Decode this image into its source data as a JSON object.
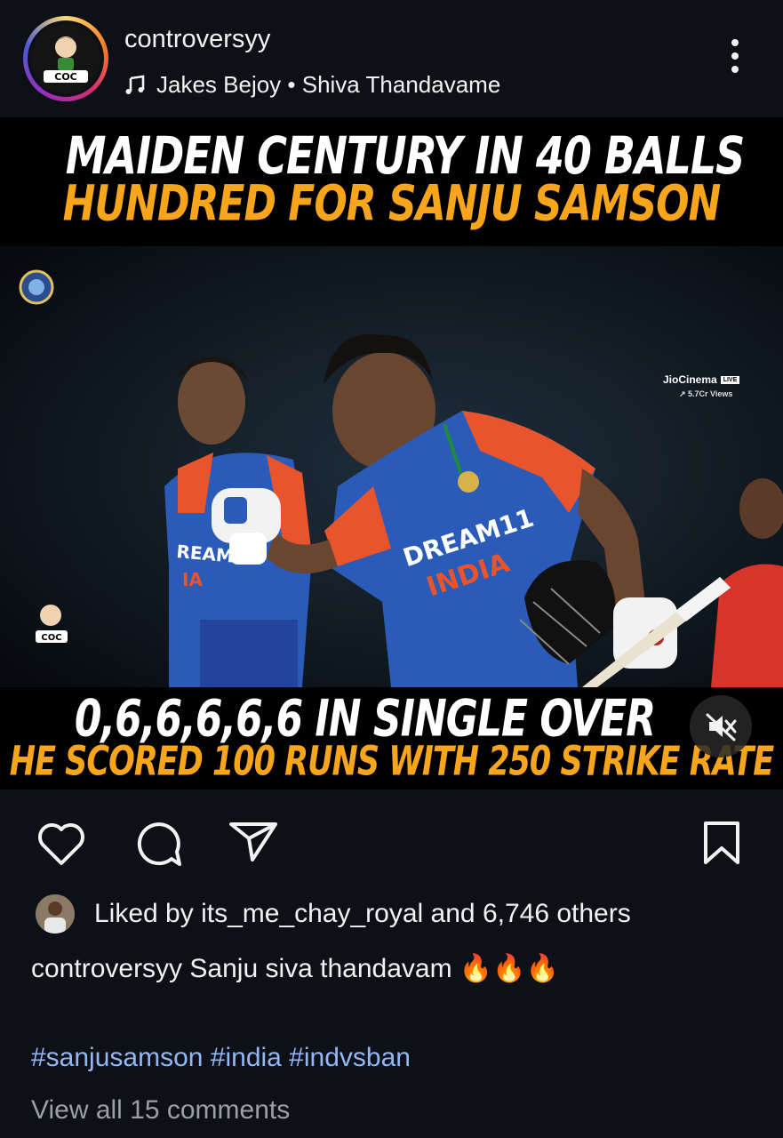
{
  "post": {
    "username": "controversyy",
    "music": "Jakes Bejoy • Shiva Thandavame",
    "avatar_text": "COC"
  },
  "media": {
    "headline_1": "MAIDEN CENTURY IN 40 BALLS",
    "headline_2": "HUNDRED FOR SANJU SAMSON",
    "bottom_1": "0,6,6,6,6,6 IN SINGLE OVER",
    "bottom_2": "HE SCORED 100 RUNS WITH 250 STRIKE RATE",
    "broadcaster": "JioCinema",
    "live_badge": "LIVE",
    "views": "5.7Cr Views",
    "jersey_sponsor": "DREAM11",
    "jersey_team": "INDIA",
    "watermark": "COC"
  },
  "engagement": {
    "likes_prefix": "Liked by ",
    "liked_by": "its_me_chay_royal",
    "likes_middle": " and ",
    "likes_count": "6,746 others",
    "caption_user": "controversyy",
    "caption_text": " Sanju siva thandavam 🔥🔥🔥",
    "hashtags": "#sanjusamson #india #indvsban",
    "view_comments": "View all 15 comments"
  },
  "colors": {
    "background": "#0d1117",
    "headline_orange": "#f7a61c",
    "hashtag_blue": "#93b6f5",
    "muted_gray": "#9aa0a6"
  },
  "icons": [
    "music-note-icon",
    "more-options-icon",
    "heart-icon",
    "comment-icon",
    "share-icon",
    "bookmark-icon",
    "mute-icon"
  ]
}
